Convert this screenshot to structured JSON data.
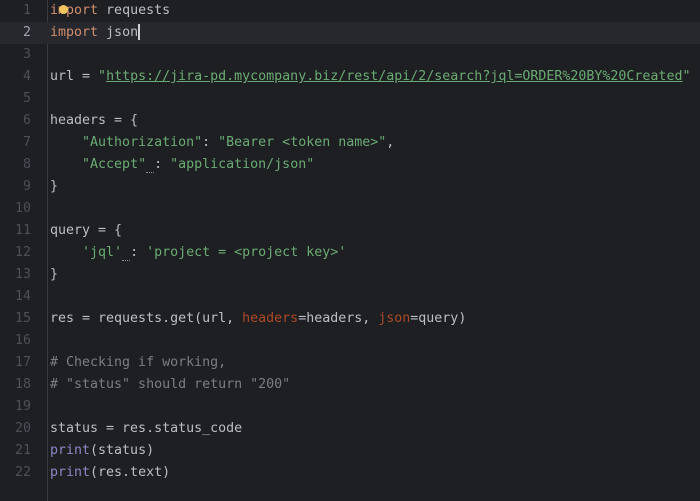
{
  "editor": {
    "current_line": 2,
    "lines": [
      {
        "n": "1",
        "tokens": [
          {
            "t": "import",
            "c": "kw"
          },
          {
            "t": " requests",
            "c": ""
          }
        ]
      },
      {
        "n": "2",
        "tokens": [
          {
            "t": "import",
            "c": "kw"
          },
          {
            "t": " json",
            "c": ""
          }
        ]
      },
      {
        "n": "3",
        "tokens": []
      },
      {
        "n": "4",
        "tokens": [
          {
            "t": "url = ",
            "c": ""
          },
          {
            "t": "\"",
            "c": "str"
          },
          {
            "t": "https://jira-pd.mycompany.biz/rest/api/2/search?jql=ORDER%20BY%20Created",
            "c": "url"
          },
          {
            "t": "\"",
            "c": "str"
          }
        ]
      },
      {
        "n": "5",
        "tokens": []
      },
      {
        "n": "6",
        "tokens": [
          {
            "t": "headers = {",
            "c": ""
          }
        ]
      },
      {
        "n": "7",
        "tokens": [
          {
            "t": "    ",
            "c": ""
          },
          {
            "t": "\"Authorization\"",
            "c": "str"
          },
          {
            "t": ": ",
            "c": ""
          },
          {
            "t": "\"Bearer <token name>\"",
            "c": "str"
          },
          {
            "t": ",",
            "c": ""
          }
        ]
      },
      {
        "n": "8",
        "tokens": [
          {
            "t": "    ",
            "c": ""
          },
          {
            "t": "\"Accept\"",
            "c": "str"
          },
          {
            "t": " ",
            "c": "squig"
          },
          {
            "t": ": ",
            "c": ""
          },
          {
            "t": "\"application/json\"",
            "c": "str"
          }
        ]
      },
      {
        "n": "9",
        "tokens": [
          {
            "t": "}",
            "c": ""
          }
        ]
      },
      {
        "n": "10",
        "tokens": []
      },
      {
        "n": "11",
        "tokens": [
          {
            "t": "query = {",
            "c": ""
          }
        ]
      },
      {
        "n": "12",
        "tokens": [
          {
            "t": "    ",
            "c": ""
          },
          {
            "t": "'jql'",
            "c": "str"
          },
          {
            "t": " ",
            "c": "squig"
          },
          {
            "t": ": ",
            "c": ""
          },
          {
            "t": "'project = <project key>'",
            "c": "str"
          }
        ]
      },
      {
        "n": "13",
        "tokens": [
          {
            "t": "}",
            "c": ""
          }
        ]
      },
      {
        "n": "14",
        "tokens": []
      },
      {
        "n": "15",
        "tokens": [
          {
            "t": "res = requests.get(url, ",
            "c": ""
          },
          {
            "t": "headers",
            "c": "kwarg"
          },
          {
            "t": "=headers, ",
            "c": ""
          },
          {
            "t": "json",
            "c": "kwarg"
          },
          {
            "t": "=query)",
            "c": ""
          }
        ]
      },
      {
        "n": "16",
        "tokens": []
      },
      {
        "n": "17",
        "tokens": [
          {
            "t": "# Checking if working,",
            "c": "cm"
          }
        ]
      },
      {
        "n": "18",
        "tokens": [
          {
            "t": "# \"status\" should return \"200\"",
            "c": "cm"
          }
        ]
      },
      {
        "n": "19",
        "tokens": []
      },
      {
        "n": "20",
        "tokens": [
          {
            "t": "status = res.status_code",
            "c": ""
          }
        ]
      },
      {
        "n": "21",
        "tokens": [
          {
            "t": "print",
            "c": "bi"
          },
          {
            "t": "(status)",
            "c": ""
          }
        ]
      },
      {
        "n": "22",
        "tokens": [
          {
            "t": "print",
            "c": "bi"
          },
          {
            "t": "(res.text)",
            "c": ""
          }
        ]
      }
    ]
  }
}
